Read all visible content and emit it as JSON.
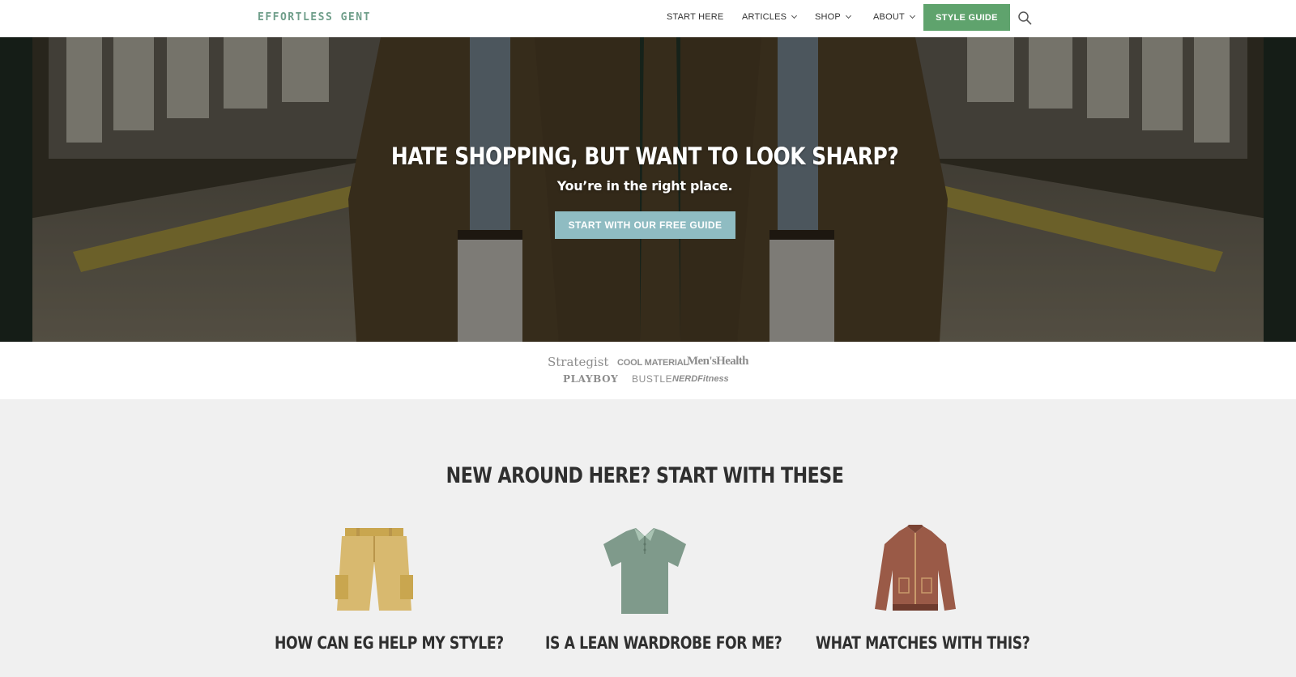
{
  "header": {
    "logo": "EFFORTLESS GENT",
    "nav": [
      {
        "label": "START HERE",
        "has_dropdown": false
      },
      {
        "label": "ARTICLES",
        "has_dropdown": true
      },
      {
        "label": "SHOP",
        "has_dropdown": true
      },
      {
        "label": "ABOUT",
        "has_dropdown": true
      }
    ],
    "cta_label": "STYLE GUIDE",
    "search_icon": "search-icon",
    "accent_color": "#5fa36d"
  },
  "hero": {
    "title": "HATE SHOPPING, BUT WANT TO LOOK SHARP?",
    "subtitle": "You’re in the right place.",
    "cta_label": "START WITH OUR FREE GUIDE",
    "cta_color": "#8fbcc2"
  },
  "press": {
    "logos": [
      "Strategist",
      "COOL MATERIAL",
      "Men'sHealth",
      "PLAYBOY",
      "BUSTLE",
      "NERDFitness"
    ]
  },
  "start_section": {
    "title": "NEW AROUND HERE? START WITH THESE",
    "cards": [
      {
        "title": "HOW CAN EG HELP MY STYLE?",
        "icon": "shorts-icon"
      },
      {
        "title": "IS A LEAN WARDROBE FOR ME?",
        "icon": "polo-shirt-icon"
      },
      {
        "title": "WHAT MATCHES WITH THIS?",
        "icon": "jacket-icon"
      }
    ]
  }
}
